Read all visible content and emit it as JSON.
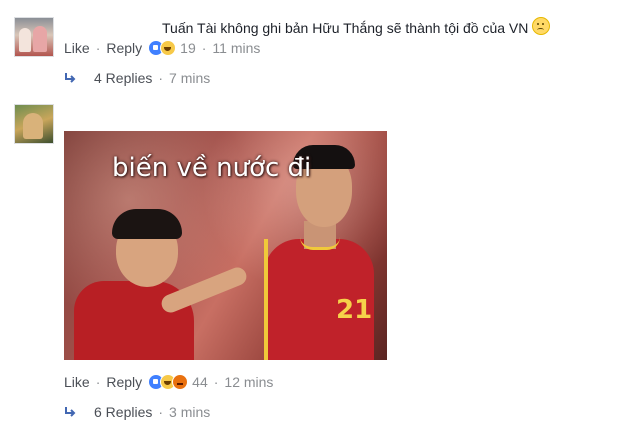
{
  "comment1": {
    "text": "Tuấn Tài không ghi bản Hữu Thắng sẽ thành tội đồ của VN",
    "emoji_icon": "worried-face-emoji",
    "actions": {
      "like_label": "Like",
      "reply_label": "Reply"
    },
    "reactions": {
      "icons": [
        "like-reaction-icon",
        "haha-reaction-icon"
      ],
      "count": "19"
    },
    "time": "11 mins",
    "replies": {
      "label": "4 Replies",
      "time": "7 mins"
    }
  },
  "comment2": {
    "photo": {
      "caption": "biến về nước đi",
      "jersey_number": "21"
    },
    "actions": {
      "like_label": "Like",
      "reply_label": "Reply"
    },
    "reactions": {
      "icons": [
        "like-reaction-icon",
        "haha-reaction-icon",
        "angry-reaction-icon"
      ],
      "count": "44"
    },
    "time": "12 mins",
    "replies": {
      "label": "6 Replies",
      "time": "3 mins"
    }
  },
  "colors": {
    "link_text": "#4b4f56",
    "meta_text": "#8a8d91",
    "reply_arrow": "#4267b2",
    "like_blue": "#4080ff"
  }
}
